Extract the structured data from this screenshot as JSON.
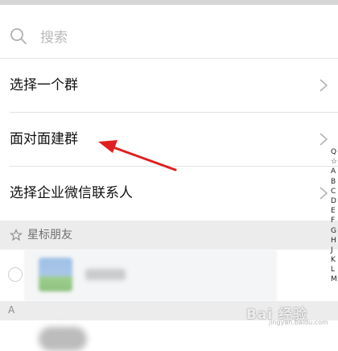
{
  "search": {
    "placeholder": "搜索"
  },
  "options": [
    {
      "label": "选择一个群"
    },
    {
      "label": "面对面建群"
    },
    {
      "label": "选择企业微信联系人"
    }
  ],
  "starred_section": {
    "title": "星标朋友"
  },
  "footer_letter": "A",
  "alphabet_index": [
    "Q",
    "☆",
    "A",
    "B",
    "C",
    "D",
    "E",
    "F",
    "G",
    "H",
    "J",
    "K",
    "L",
    "M"
  ],
  "watermark": {
    "text": "Bai 经验",
    "sub": "jingyan.baidu.com"
  },
  "colors": {
    "annotation_arrow": "#e02020",
    "section_background": "#ececec"
  }
}
